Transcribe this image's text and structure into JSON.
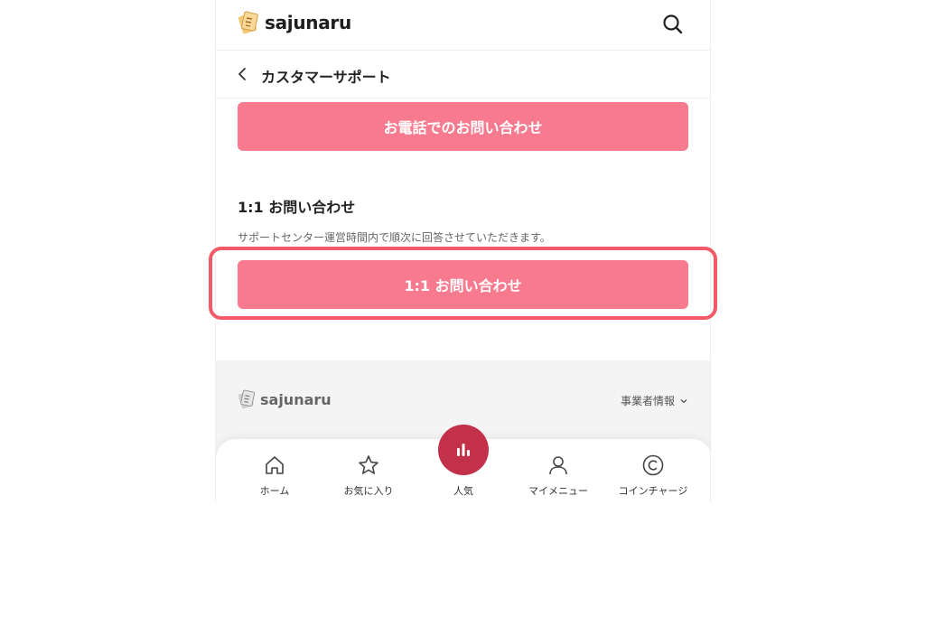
{
  "header": {
    "brand": "sajunaru",
    "search_icon": "search-icon"
  },
  "subheader": {
    "back_icon": "chevron-left-icon",
    "title": "カスタマーサポート"
  },
  "content": {
    "phone_button": "お電話でのお問い合わせ",
    "inquiry_title": "1:1 お問い合わせ",
    "inquiry_desc": "サポートセンター運営時間内で順次に回答させていただきます。",
    "inquiry_button": "1:1 お問い合わせ"
  },
  "footer": {
    "brand": "sajunaru",
    "business_info": "事業者情報"
  },
  "tabbar": {
    "items": [
      {
        "label": "ホーム",
        "icon": "home-icon"
      },
      {
        "label": "お気に入り",
        "icon": "star-icon"
      },
      {
        "label": "人気",
        "icon": "bar-chart-icon"
      },
      {
        "label": "マイメニュー",
        "icon": "user-icon"
      },
      {
        "label": "コインチャージ",
        "icon": "coin-icon"
      }
    ]
  },
  "colors": {
    "primary_button": "#f77a8f",
    "highlight_border": "#f25a68",
    "popular_circle": "#c2304a"
  }
}
